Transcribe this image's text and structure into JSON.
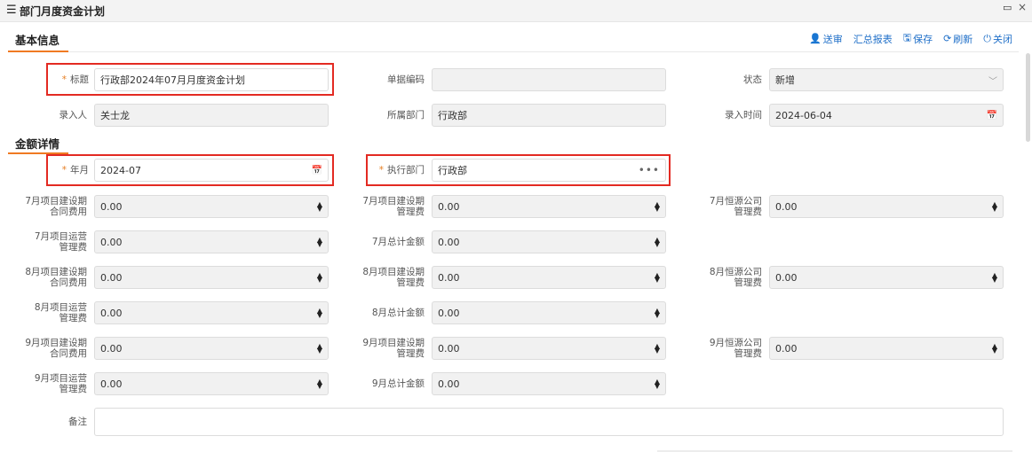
{
  "window": {
    "title": "部门月度资金计划"
  },
  "toolbar": {
    "submit": "送审",
    "report": "汇总报表",
    "save": "保存",
    "refresh": "刷新",
    "close": "关闭"
  },
  "sections": {
    "basic": "基本信息",
    "amount": "金额详情"
  },
  "basic": {
    "title_label": "标题",
    "title_value": "行政部2024年07月月度资金计划",
    "code_label": "单据编码",
    "code_value": "",
    "status_label": "状态",
    "status_value": "新增",
    "entrant_label": "录入人",
    "entrant_value": "关士龙",
    "dept_label": "所属部门",
    "dept_value": "行政部",
    "entry_time_label": "录入时间",
    "entry_time_value": "2024-06-04"
  },
  "amount": {
    "month_label": "年月",
    "month_value": "2024-07",
    "exec_dept_label": "执行部门",
    "exec_dept_value": "行政部",
    "jul_a_label": [
      "7月项目建设期",
      "合同费用"
    ],
    "jul_a_value": "0.00",
    "jul_b_label": [
      "7月项目建设期",
      "管理费"
    ],
    "jul_b_value": "0.00",
    "jul_c_label": [
      "7月恒源公司",
      "管理费"
    ],
    "jul_c_value": "0.00",
    "jul_d_label": [
      "7月项目运营",
      "管理费"
    ],
    "jul_d_value": "0.00",
    "jul_total_label": "7月总计金额",
    "jul_total_value": "0.00",
    "aug_a_label": [
      "8月项目建设期",
      "合同费用"
    ],
    "aug_a_value": "0.00",
    "aug_b_label": [
      "8月项目建设期",
      "管理费"
    ],
    "aug_b_value": "0.00",
    "aug_c_label": [
      "8月恒源公司",
      "管理费"
    ],
    "aug_c_value": "0.00",
    "aug_d_label": [
      "8月项目运营",
      "管理费"
    ],
    "aug_d_value": "0.00",
    "aug_total_label": "8月总计金额",
    "aug_total_value": "0.00",
    "sep_a_label": [
      "9月项目建设期",
      "合同费用"
    ],
    "sep_a_value": "0.00",
    "sep_b_label": [
      "9月项目建设期",
      "管理费"
    ],
    "sep_b_value": "0.00",
    "sep_c_label": [
      "9月恒源公司",
      "管理费"
    ],
    "sep_c_value": "0.00",
    "sep_d_label": [
      "9月项目运营",
      "管理费"
    ],
    "sep_d_value": "0.00",
    "sep_total_label": "9月总计金额",
    "sep_total_value": "0.00",
    "remark_label": "备注",
    "remark_value": ""
  },
  "colors": {
    "accent": "#f07a22",
    "link": "#1f6fc8",
    "highlight": "#e32a22",
    "required": "#e67e22"
  },
  "icons": {
    "menu": "menu-icon",
    "maximize": "maximize-icon",
    "close": "close-icon",
    "submit": "user-send-icon",
    "save": "save-icon",
    "refresh": "refresh-icon",
    "power": "power-icon",
    "calendar": "calendar-icon",
    "spinner": "spinner-icon"
  }
}
